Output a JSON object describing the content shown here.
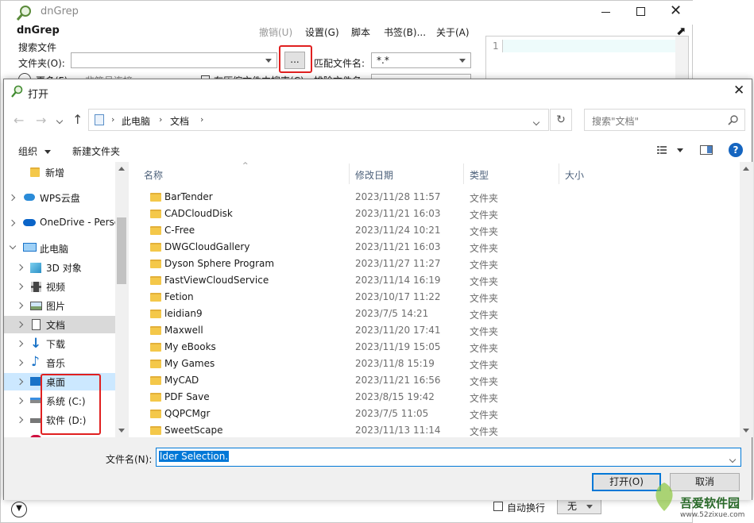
{
  "bg_window": {
    "title": "dnGrep",
    "app_name": "dnGrep",
    "menu": [
      "撤销(U)",
      "设置(G)",
      "脚本",
      "书签(B)...",
      "关于(A)"
    ],
    "search_files_label": "搜索文件",
    "folder_label": "文件夹(O):",
    "browse_label": "...",
    "match_label": "匹配文件名:",
    "match_value": "*.*",
    "more_label": "更多(F)",
    "symlink_label": "非符号连接",
    "archive_label": "在压缩文件中搜索(C)",
    "exclude_label": "排除文件名:",
    "editor_line": "1",
    "wrap_label": "自动换行",
    "wrap_value": "无"
  },
  "dialog": {
    "title": "打开",
    "breadcrumb": [
      "此电脑",
      "文档"
    ],
    "search_placeholder": "搜索\"文档\"",
    "toolbar": {
      "organize": "组织",
      "new_folder": "新建文件夹"
    },
    "nav": [
      {
        "label": "新增",
        "icon": "folder-icon"
      },
      {
        "label": "WPS云盘",
        "icon": "cloud-icon"
      },
      {
        "label": "OneDrive - Perso",
        "icon": "onedrive-icon"
      },
      {
        "label": "此电脑",
        "icon": "computer-icon"
      },
      {
        "label": "3D 对象",
        "icon": "cube-icon"
      },
      {
        "label": "视频",
        "icon": "video-icon"
      },
      {
        "label": "图片",
        "icon": "picture-icon"
      },
      {
        "label": "文档",
        "icon": "document-icon"
      },
      {
        "label": "下载",
        "icon": "download-icon"
      },
      {
        "label": "音乐",
        "icon": "music-icon"
      },
      {
        "label": "桌面",
        "icon": "desktop-icon"
      },
      {
        "label": "系统 (C:)",
        "icon": "drive-icon"
      },
      {
        "label": "软件 (D:)",
        "icon": "drive-icon"
      }
    ],
    "columns": [
      "名称",
      "修改日期",
      "类型",
      "大小"
    ],
    "files": [
      {
        "name": "BarTender",
        "date": "2023/11/28 11:57",
        "type": "文件夹"
      },
      {
        "name": "CADCloudDisk",
        "date": "2023/11/21 16:03",
        "type": "文件夹"
      },
      {
        "name": "C-Free",
        "date": "2023/11/24 10:21",
        "type": "文件夹"
      },
      {
        "name": "DWGCloudGallery",
        "date": "2023/11/21 16:03",
        "type": "文件夹"
      },
      {
        "name": "Dyson Sphere Program",
        "date": "2023/11/27 11:27",
        "type": "文件夹"
      },
      {
        "name": "FastViewCloudService",
        "date": "2023/11/14 16:19",
        "type": "文件夹"
      },
      {
        "name": "Fetion",
        "date": "2023/10/17 11:22",
        "type": "文件夹"
      },
      {
        "name": "leidian9",
        "date": "2023/7/5 14:21",
        "type": "文件夹"
      },
      {
        "name": "Maxwell",
        "date": "2023/11/20 17:41",
        "type": "文件夹"
      },
      {
        "name": "My eBooks",
        "date": "2023/11/19 15:05",
        "type": "文件夹"
      },
      {
        "name": "My Games",
        "date": "2023/11/8 15:19",
        "type": "文件夹"
      },
      {
        "name": "MyCAD",
        "date": "2023/11/21 16:56",
        "type": "文件夹"
      },
      {
        "name": "PDF Save",
        "date": "2023/8/15 19:42",
        "type": "文件夹"
      },
      {
        "name": "QQPCMgr",
        "date": "2023/7/5 11:05",
        "type": "文件夹"
      },
      {
        "name": "SweetScape",
        "date": "2023/11/13 11:14",
        "type": "文件夹"
      }
    ],
    "filename_label": "文件名(N):",
    "filename_value": "lder Selection.",
    "open_button": "打开(O)",
    "cancel_button": "取消"
  },
  "watermark": {
    "text": "吾爱软件园",
    "url": "www.52zixue.com"
  },
  "colors": {
    "highlight_red": "#e02020",
    "accent_blue": "#0078d7",
    "folder_yellow": "#f4c84a",
    "selected_nav": "#cce8ff"
  }
}
